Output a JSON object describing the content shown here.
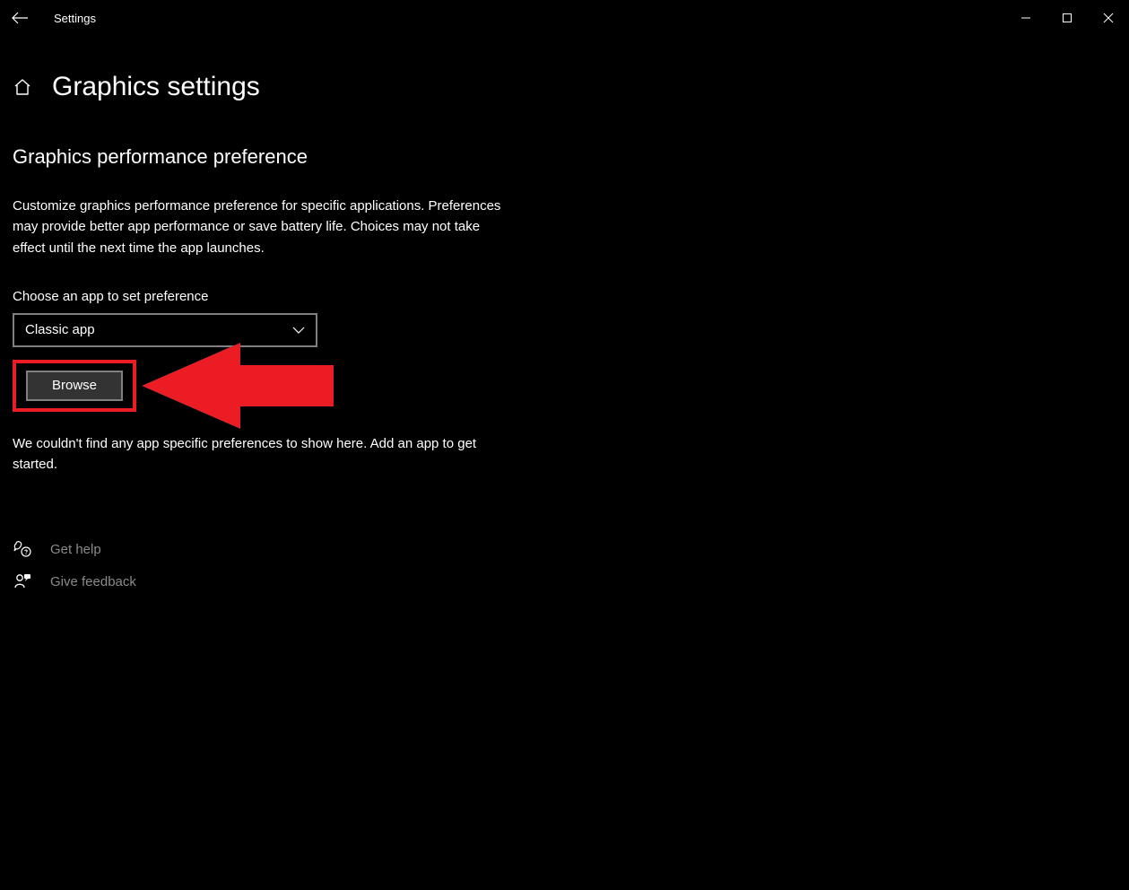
{
  "titlebar": {
    "window_title": "Settings"
  },
  "header": {
    "page_title": "Graphics settings"
  },
  "section": {
    "heading": "Graphics performance preference",
    "description": "Customize graphics performance preference for specific applications. Preferences may provide better app performance or save battery life. Choices may not take effect until the next time the app launches.",
    "choose_label": "Choose an app to set preference",
    "dropdown_value": "Classic app",
    "browse_label": "Browse",
    "empty_message": "We couldn't find any app specific preferences to show here. Add an app to get started."
  },
  "links": {
    "help": "Get help",
    "feedback": "Give feedback"
  },
  "annotation": {
    "highlight_color": "#ec1c24"
  }
}
